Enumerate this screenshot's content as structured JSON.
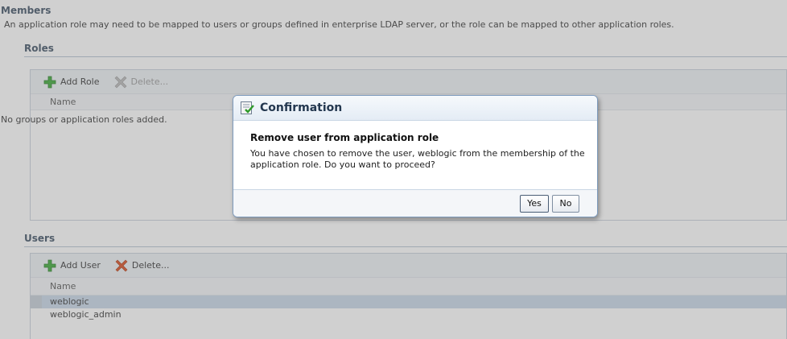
{
  "members": {
    "title": "Members",
    "description": "An application role may need to be mapped to users or groups defined in enterprise LDAP server, or the role can be mapped to other application roles."
  },
  "roles": {
    "title": "Roles",
    "toolbar": {
      "add_label": "Add Role",
      "delete_label": "Delete..."
    },
    "column_name": "Name",
    "empty_text": "No groups or application roles added."
  },
  "users": {
    "title": "Users",
    "toolbar": {
      "add_label": "Add User",
      "delete_label": "Delete..."
    },
    "column_name": "Name",
    "rows": [
      {
        "name": "weblogic",
        "selected": true
      },
      {
        "name": "weblogic_admin",
        "selected": false
      }
    ]
  },
  "dialog": {
    "title": "Confirmation",
    "heading": "Remove user from application role",
    "message": "You have chosen to remove the user, weblogic from the membership of the application role. Do you want to proceed?",
    "yes_label": "Yes",
    "no_label": "No"
  },
  "icons": {
    "add": "plus-icon",
    "delete": "delete-x-icon",
    "confirm": "confirmation-check-icon"
  },
  "colors": {
    "section_title": "#3d4f63",
    "add_icon": "#39a935",
    "delete_icon": "#d94b1e",
    "selected_row": "#c8d7e8"
  }
}
